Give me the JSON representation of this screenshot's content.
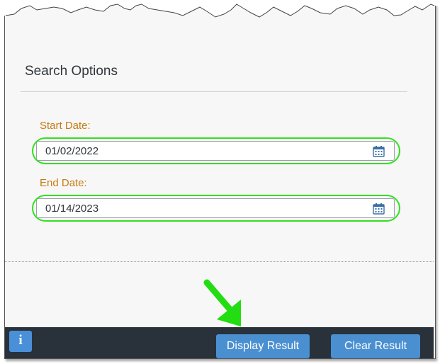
{
  "search_options": {
    "title": "Search Options",
    "start_date": {
      "label": "Start Date:",
      "value": "01/02/2022"
    },
    "end_date": {
      "label": "End Date:",
      "value": "01/14/2023"
    }
  },
  "footer": {
    "info_label": "i",
    "display_result_label": "Display Result",
    "clear_result_label": "Clear Result"
  },
  "colors": {
    "label": "#c87b12",
    "highlight": "#33e020",
    "footer_bg": "#29313a",
    "button_bg": "#4a8fd0"
  }
}
